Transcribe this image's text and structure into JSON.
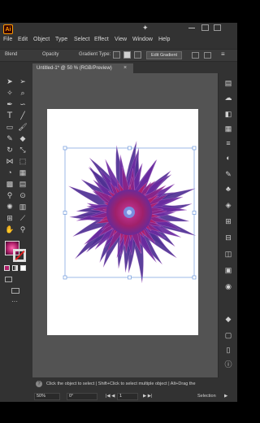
{
  "menubar": {
    "logo_text": "Ai",
    "items": [
      "File",
      "Edit",
      "Object",
      "Type",
      "Select",
      "Effect",
      "View",
      "Window",
      "Help"
    ]
  },
  "control_bar": {
    "blend_label": "Blend",
    "opacity_label": "Opacity",
    "gradient_type_label": "Gradient Type:",
    "edit_gradient_label": "Edit Gradient"
  },
  "document": {
    "tab_title": "Untitled-1* @ 50 % (RGB/Preview)",
    "close_symbol": "×"
  },
  "status": {
    "hint": "Click the object to select  |  Shift+Click to select multiple object  |  Alt+Drag the",
    "zoom": "50%",
    "rotation": "0°",
    "artboard_number": "1",
    "tool_name": "Selection"
  },
  "colors": {
    "app_bg": "#323232",
    "canvas_bg": "#535353",
    "artboard": "#ffffff",
    "flower_outer": "#5a2d8f",
    "flower_inner": "#b01e6b",
    "flower_center": "#8fb6ff"
  }
}
